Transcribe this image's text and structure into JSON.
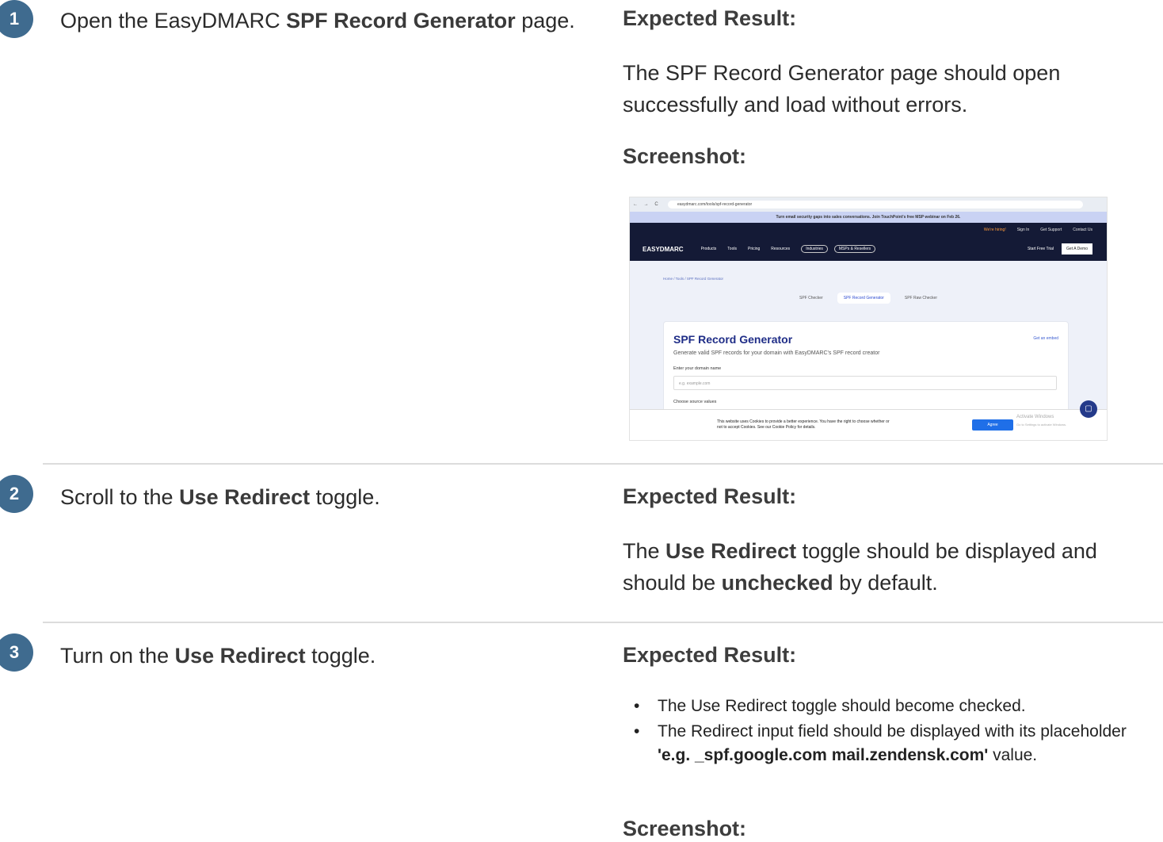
{
  "step1": {
    "number": "1",
    "text_pre": "Open the EasyDMARC ",
    "text_bold": "SPF Record Generator",
    "text_post": " page.",
    "expected_label": "Expected Result:",
    "expected_text": "The SPF Record Generator page should open successfully and load without errors.",
    "screenshot_label": "Screenshot:"
  },
  "screenshot": {
    "nav_glyphs": "← → C",
    "url": "easydmarc.com/tools/spf-record-generator",
    "banner": "Turn email security gaps into sales conversations. Join TouchPoint's free MSP webinar on Feb 26.",
    "top_links": [
      "We're hiring!",
      "Sign In",
      "Get Support",
      "Contact Us"
    ],
    "logo": "EASYDMARC",
    "menu": [
      "Products",
      "Tools",
      "Pricing",
      "Resources"
    ],
    "pills": [
      "Industries",
      "MSPs & Resellers"
    ],
    "trial": "Start Free Trial",
    "demo": "Get A Demo",
    "breadcrumb": "Home / Tools / SPF Record Generator",
    "tabs": [
      "SPF Checker",
      "SPF Record Generator",
      "SPF Raw Checker"
    ],
    "card_title": "SPF Record Generator",
    "embed": "Get an embed",
    "card_subtitle": "Generate valid SPF records for your domain with EasyDMARC's SPF record creator",
    "domain_label": "Enter your domain name",
    "domain_placeholder": "e.g. example.com",
    "source_label": "Choose source values",
    "cookie_text": "This website uses Cookies to provide a better experience. You have the right to choose whether or not to accept Cookies. See our Cookie Policy for details.",
    "agree": "Agree",
    "activate": "Activate Windows",
    "activate_sub": "Go to Settings to activate Windows."
  },
  "step2": {
    "number": "2",
    "text_pre": "Scroll to the ",
    "text_bold": "Use Redirect",
    "text_post": " toggle.",
    "expected_label": "Expected Result:",
    "exp_pre": "The ",
    "exp_bold1": "Use Redirect",
    "exp_mid": " toggle should be displayed and should be ",
    "exp_bold2": "unchecked",
    "exp_post": " by default."
  },
  "step3": {
    "number": "3",
    "text_pre": "Turn on the ",
    "text_bold": "Use Redirect",
    "text_post": " toggle.",
    "expected_label": "Expected Result:",
    "bullet_glyph": "•",
    "bullet1": "The Use Redirect toggle should become checked.",
    "bullet2_pre": "The Redirect input field should be displayed with its placeholder  ",
    "bullet2_bold": "'e.g. _spf.google.com mail.zendensk.com'",
    "bullet2_post": " value.",
    "screenshot_label": "Screenshot:"
  }
}
